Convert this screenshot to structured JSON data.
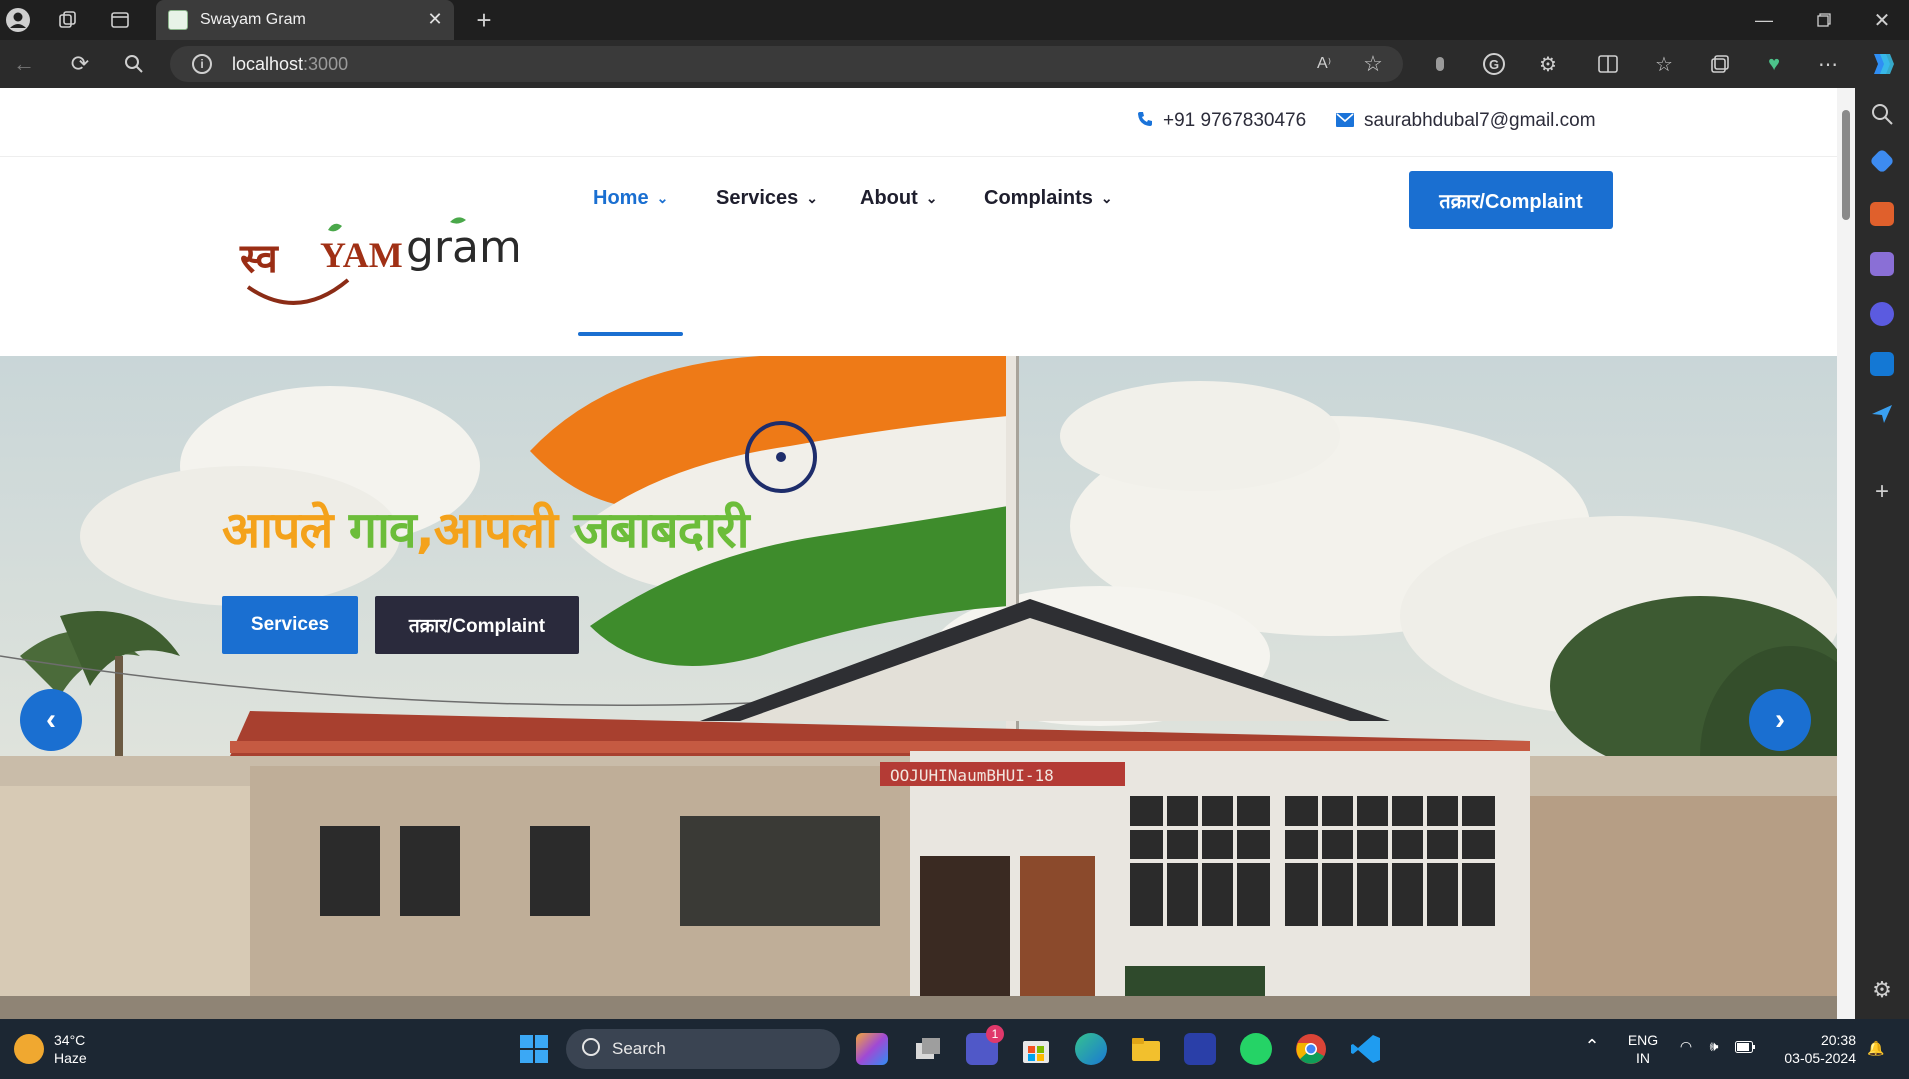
{
  "browser": {
    "tab_title": "Swayam Gram",
    "url_host": "localhost",
    "url_port": ":3000"
  },
  "topbar": {
    "phone": "+91 9767830476",
    "email": "saurabhdubal7@gmail.com"
  },
  "nav": {
    "items": [
      {
        "label": "Home"
      },
      {
        "label": "Services"
      },
      {
        "label": "About"
      },
      {
        "label": "Complaints"
      }
    ],
    "cta": "तक्रार/Complaint"
  },
  "logo": {
    "text_left": "स्व",
    "text_mid": "YAM",
    "text_right": "gram"
  },
  "hero": {
    "title_part1": "आपले ",
    "title_part2": "गाव",
    "title_part3": ",आपली ",
    "title_part4": "जबाबदारी",
    "btn_services": "Services",
    "btn_complaint": "तक्रार/Complaint",
    "signboard": "OOJUHINaumBHUI-18",
    "colors": {
      "accent": "#1a6fd1",
      "saffron": "#f4a21b",
      "green": "#6cbd3a"
    }
  },
  "taskbar": {
    "temp": "34°C",
    "condition": "Haze",
    "search": "Search",
    "lang1": "ENG",
    "lang2": "IN",
    "time": "20:38",
    "date": "03-05-2024",
    "teams_badge": "1"
  }
}
